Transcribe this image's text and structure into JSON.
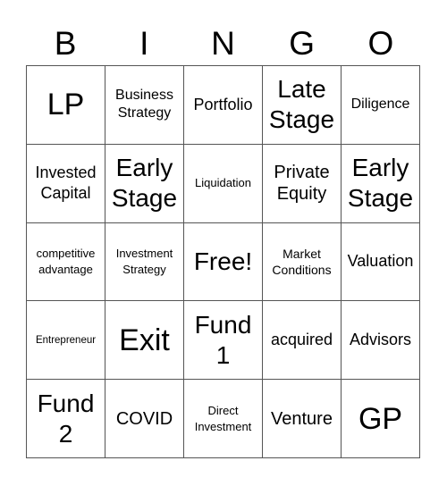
{
  "header": {
    "letters": [
      "B",
      "I",
      "N",
      "G",
      "O"
    ]
  },
  "cells": [
    [
      "LP",
      "Business Strategy",
      "Portfolio",
      "Late Stage",
      "Diligence"
    ],
    [
      "Invested Capital",
      "Early Stage",
      "Liquidation",
      "Private Equity",
      "Early Stage"
    ],
    [
      "competitive advantage",
      "Investment Strategy",
      "Free!",
      "Market Conditions",
      "Valuation"
    ],
    [
      "Entrepreneur",
      "Exit",
      "Fund 1",
      "acquired",
      "Advisors"
    ],
    [
      "Fund 2",
      "COVID",
      "Direct Investment",
      "Venture",
      "GP"
    ]
  ]
}
